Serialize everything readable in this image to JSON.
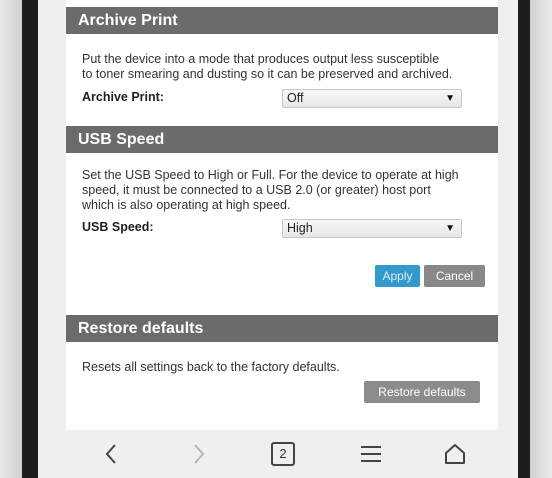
{
  "archive": {
    "header": "Archive Print",
    "description_line1": "Put the device into a mode that produces output less susceptible",
    "description_line2": "to toner smearing and dusting so it can be preserved and archived.",
    "label": "Archive Print:",
    "value": "Off"
  },
  "usb": {
    "header": "USB Speed",
    "description_line1": "Set the USB Speed to High or Full. For the device to operate at high",
    "description_line2": "speed, it must be connected to a USB 2.0 (or greater) host port",
    "description_line3": "which is also operating at high speed.",
    "label": "USB Speed:",
    "value": "High",
    "apply_label": "Apply",
    "cancel_label": "Cancel"
  },
  "restore": {
    "header": "Restore defaults",
    "description": "Resets all settings back to the factory defaults.",
    "button_label": "Restore defaults"
  },
  "navbar": {
    "tab_count": "2",
    "icons": [
      "back-icon",
      "forward-icon",
      "tabs-icon",
      "menu-icon",
      "home-icon"
    ]
  }
}
